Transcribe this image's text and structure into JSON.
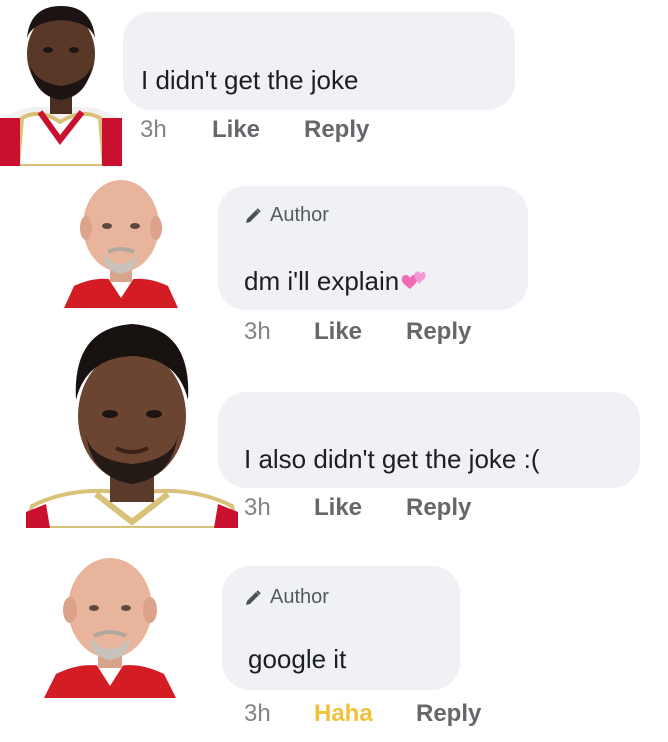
{
  "comments": [
    {
      "text": "I didn't get the joke",
      "author_badge": "",
      "time": "3h",
      "reaction": "Like",
      "reply": "Reply"
    },
    {
      "text": "dm i'll explain",
      "author_badge": "Author",
      "emoji": "heart-emoji",
      "time": "3h",
      "reaction": "Like",
      "reply": "Reply"
    },
    {
      "text": "I also didn't get the joke :(",
      "author_badge": "",
      "time": "3h",
      "reaction": "Like",
      "reply": "Reply"
    },
    {
      "text": "google it",
      "author_badge": "Author",
      "time": "3h",
      "reaction": "Haha",
      "reaction_color": "#f0c23a",
      "reply": "Reply"
    }
  ],
  "icons": {
    "author": "pencil-icon",
    "emoji": "heart-icon"
  }
}
